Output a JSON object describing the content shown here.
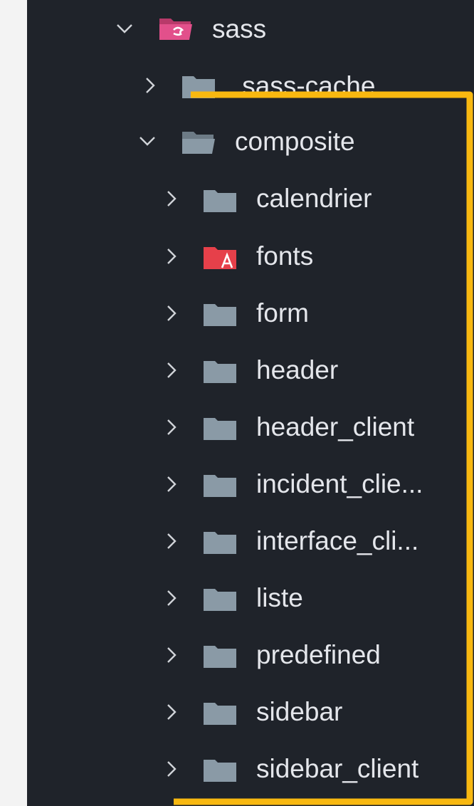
{
  "explorer": {
    "colors": {
      "background": "#1f232a",
      "text": "#e4e6eb",
      "folder": "#8a9aa6",
      "sass_folder": "#e2508b",
      "fonts_folder": "#e6404a",
      "highlight": "#f8b810"
    },
    "items": [
      {
        "label": "sass",
        "expanded": true,
        "icon": "sass-folder-open-icon"
      },
      {
        "label": ".sass-cache",
        "expanded": false,
        "icon": "folder-icon"
      },
      {
        "label": "composite",
        "expanded": true,
        "icon": "folder-open-icon"
      },
      {
        "label": "calendrier",
        "expanded": false,
        "icon": "folder-icon"
      },
      {
        "label": "fonts",
        "expanded": false,
        "icon": "fonts-folder-icon"
      },
      {
        "label": "form",
        "expanded": false,
        "icon": "folder-icon"
      },
      {
        "label": "header",
        "expanded": false,
        "icon": "folder-icon"
      },
      {
        "label": "header_client",
        "expanded": false,
        "icon": "folder-icon"
      },
      {
        "label": "incident_clie...",
        "expanded": false,
        "icon": "folder-icon"
      },
      {
        "label": "interface_cli...",
        "expanded": false,
        "icon": "folder-icon"
      },
      {
        "label": "liste",
        "expanded": false,
        "icon": "folder-icon"
      },
      {
        "label": "predefined",
        "expanded": false,
        "icon": "folder-icon"
      },
      {
        "label": "sidebar",
        "expanded": false,
        "icon": "folder-icon"
      },
      {
        "label": "sidebar_client",
        "expanded": false,
        "icon": "folder-icon"
      }
    ]
  }
}
